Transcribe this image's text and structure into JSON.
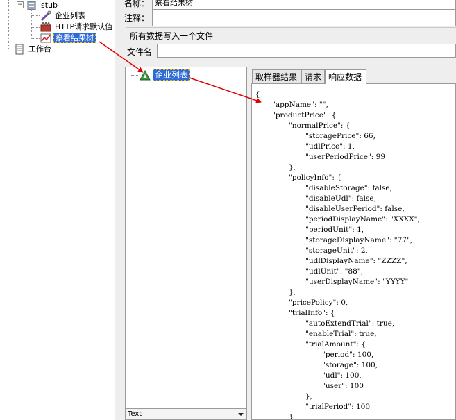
{
  "left_tree": {
    "stub_label": "stub",
    "item_list_label": "企业列表",
    "http_defaults_label": "HTTP请求默认值",
    "view_results_label": "察看结果树",
    "workbench_label": "工作台"
  },
  "right_panel": {
    "name_label": "名称：",
    "name_value": "察看结果树",
    "comment_label": "注释：",
    "section_title": "所有数据写入一个文件",
    "filename_label": "文件名",
    "filename_value": ""
  },
  "result_tree": {
    "item_label": "企业列表",
    "renderer_value": "Text"
  },
  "tabs": {
    "sampler_result": "取样器结果",
    "request": "请求",
    "response": "响应数据"
  },
  "response_lines": [
    "{",
    "\"appName\": \"\",",
    "\"productPrice\": {",
    "\"normalPrice\": {",
    "\"storagePrice\": 66,",
    "\"udlPrice\": 1,",
    "\"userPeriodPrice\": 99",
    "},",
    "\"policyInfo\": {",
    "\"disableStorage\": false,",
    "\"disableUdl\": false,",
    "\"disableUserPeriod\": false,",
    "\"periodDisplayName\": \"XXXX\",",
    "\"periodUnit\": 1,",
    "\"storageDisplayName\": \"77\",",
    "\"storageUnit\": 2,",
    "\"udlDisplayName\": \"ZZZZ\",",
    "\"udlUnit\": \"88\",",
    "\"userDisplayName\": \"YYYY\"",
    "},",
    "\"pricePolicy\": 0,",
    "\"trialInfo\": {",
    "\"autoExtendTrial\": true,",
    "\"enableTrial\": true,",
    "\"trialAmount\": {",
    "\"period\": 100,",
    "\"storage\": 100,",
    "\"udl\": 100,",
    "\"user\": 100",
    "},",
    "\"trialPeriod\": 100",
    "}"
  ],
  "colors": {
    "selection": "#2f6bd6",
    "annotation_arrow": "#e00000",
    "panel_bg": "#eeeeee"
  }
}
